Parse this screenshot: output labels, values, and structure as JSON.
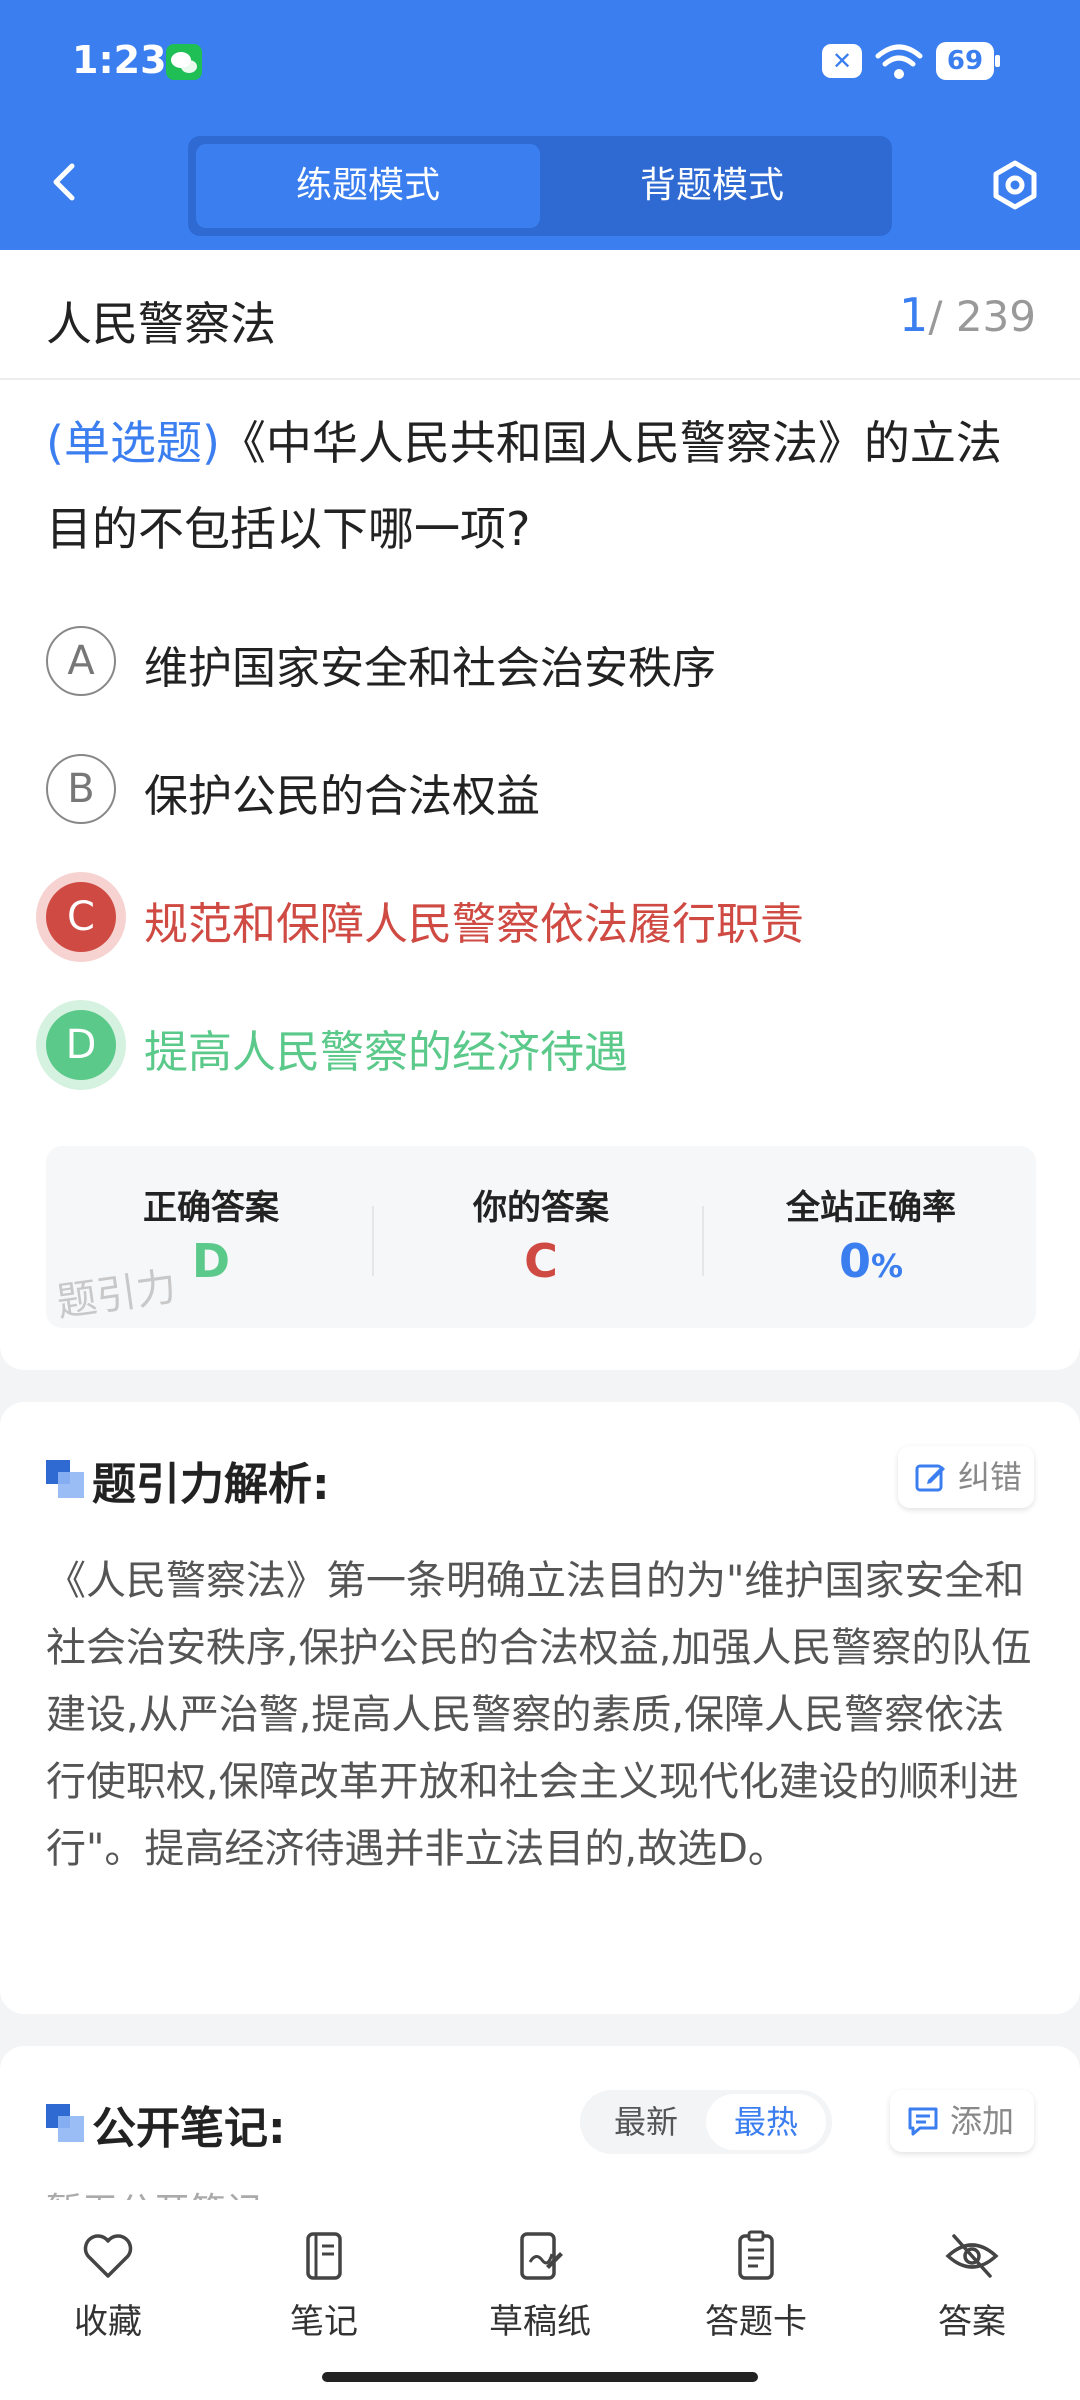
{
  "status": {
    "time": "1:23",
    "battery": "69"
  },
  "header": {
    "tabs": [
      {
        "label": "练题模式",
        "active": true
      },
      {
        "label": "背题模式",
        "active": false
      }
    ],
    "accent": "#3b7ef0"
  },
  "section": {
    "title": "人民警察法",
    "current": "1",
    "total": "/ 239"
  },
  "question": {
    "type": "(单选题)",
    "text": "《中华人民共和国人民警察法》的立法目的不包括以下哪一项?",
    "options": [
      {
        "letter": "A",
        "text": "维护国家安全和社会治安秩序",
        "state": "normal"
      },
      {
        "letter": "B",
        "text": "保护公民的合法权益",
        "state": "normal"
      },
      {
        "letter": "C",
        "text": "规范和保障人民警察依法履行职责",
        "state": "wrong"
      },
      {
        "letter": "D",
        "text": "提高人民警察的经济待遇",
        "state": "correct"
      }
    ]
  },
  "answers": {
    "correct_label": "正确答案",
    "correct_value": "D",
    "yours_label": "你的答案",
    "yours_value": "C",
    "rate_label": "全站正确率",
    "rate_value": "0",
    "rate_unit": "%",
    "watermark": "题引力"
  },
  "analysis": {
    "title": "题引力解析:",
    "report_label": "纠错",
    "text": "《人民警察法》第一条明确立法目的为\"维护国家安全和社会治安秩序,保护公民的合法权益,加强人民警察的队伍建设,从严治警,提高人民警察的素质,保障人民警察依法行使职权,保障改革开放和社会主义现代化建设的顺利进行\"。提高经济待遇并非立法目的,故选D。"
  },
  "notes": {
    "title": "公开笔记:",
    "sort_options": [
      "最新",
      "最热"
    ],
    "add_label": "添加",
    "empty_text": "暂无公开笔记"
  },
  "bottom_nav": [
    {
      "label": "收藏",
      "icon": "heart-icon"
    },
    {
      "label": "笔记",
      "icon": "notebook-icon"
    },
    {
      "label": "草稿纸",
      "icon": "draft-icon"
    },
    {
      "label": "答题卡",
      "icon": "answer-card-icon"
    },
    {
      "label": "答案",
      "icon": "eye-off-icon"
    }
  ],
  "colors": {
    "wrong": "#d04a44",
    "correct": "#5bc98a",
    "primary": "#3b7ef0"
  }
}
